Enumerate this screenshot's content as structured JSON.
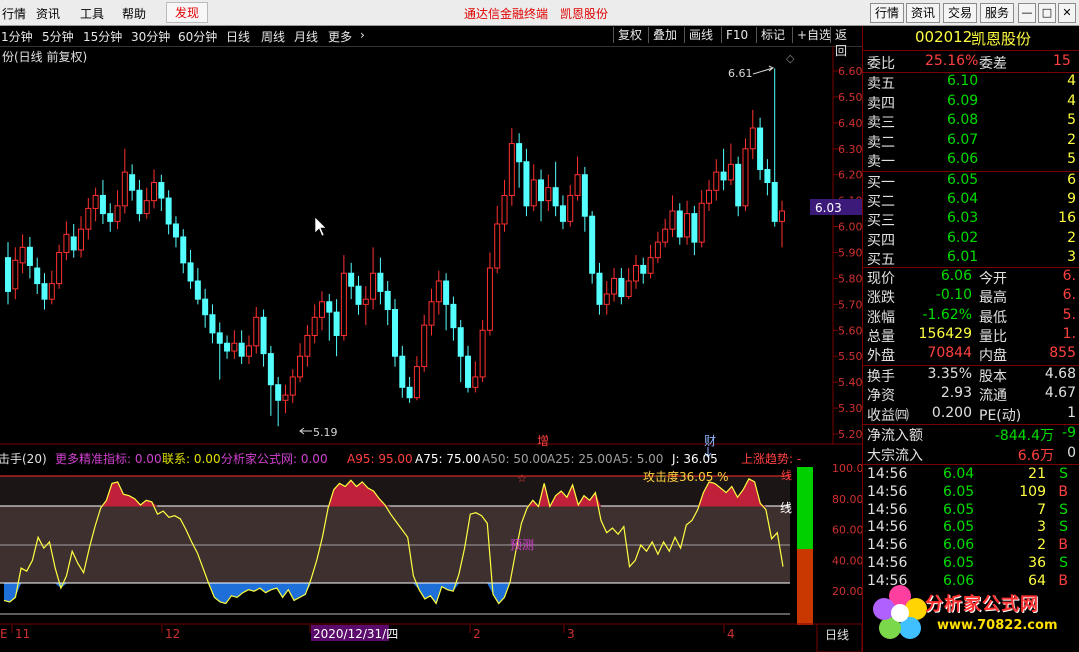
{
  "menu": {
    "items": [
      "行情",
      "资讯",
      "工具",
      "帮助"
    ],
    "discover": "发现",
    "title": "通达信金融终端　凯恩股份",
    "right_buttons": [
      "行情",
      "资讯",
      "交易",
      "服务"
    ]
  },
  "period_bar": {
    "periods": [
      "1分钟",
      "5分钟",
      "15分钟",
      "30分钟",
      "60分钟",
      "日线",
      "周线",
      "月线",
      "更多",
      "›"
    ],
    "tools": [
      "复权",
      "叠加",
      "画线",
      "F10",
      "标记",
      "+自选",
      "返回"
    ]
  },
  "chart": {
    "header": "份(日线 前复权)",
    "price_axis": [
      "6.60",
      "6.50",
      "6.40",
      "6.30",
      "6.20",
      "6.10",
      "6.00",
      "5.90",
      "5.80",
      "5.70",
      "5.60",
      "5.50",
      "5.40",
      "5.30",
      "5.20"
    ],
    "current_price_tag": "6.03",
    "high_annotation": "6.61",
    "low_annotation": "5.19",
    "marker_zeng": "增",
    "marker_cai": "财"
  },
  "indicator": {
    "name": "击手(20)",
    "legend": [
      {
        "text": "更多精准指标: 0.00",
        "color": "#d040d0"
      },
      {
        "text": "联系: 0.00",
        "color": "#e0e000"
      },
      {
        "text": "分析家公式网: 0.00",
        "color": "#d040d0"
      },
      {
        "text": "A95: 95.00",
        "color": "#ff4040"
      },
      {
        "text": "A75: 75.00",
        "color": "#ffffff"
      },
      {
        "text": "A50: 50.00",
        "color": "#a0a0a0"
      },
      {
        "text": "A25: 25.00",
        "color": "#a0a0a0"
      },
      {
        "text": "A5: 5.00",
        "color": "#a0a0a0"
      },
      {
        "text": "J: 36.05",
        "color": "#ffffff"
      },
      {
        "text": "上涨趋势: -",
        "color": "#ff4040"
      }
    ],
    "axis": [
      "100.00",
      "80.00",
      "60.00",
      "40.00",
      "20.00"
    ],
    "attack_label": "攻击度36.05 %",
    "predict_label": "预测",
    "line_label": "线",
    "line_label2": "线"
  },
  "date_axis": {
    "labels": [
      "11",
      "12",
      "2020/12/31/四",
      "2",
      "3",
      "4"
    ],
    "mode": "日线"
  },
  "quote": {
    "code": "002012",
    "name": "凯恩股份",
    "weibi_label": "委比",
    "weibi_value": "25.16%",
    "weicha_label": "委差",
    "weicha_value": "15",
    "sells": [
      {
        "label": "卖五",
        "price": "6.10",
        "vol": "4"
      },
      {
        "label": "卖四",
        "price": "6.09",
        "vol": "4"
      },
      {
        "label": "卖三",
        "price": "6.08",
        "vol": "5"
      },
      {
        "label": "卖二",
        "price": "6.07",
        "vol": "2"
      },
      {
        "label": "卖一",
        "price": "6.06",
        "vol": "5"
      }
    ],
    "buys": [
      {
        "label": "买一",
        "price": "6.05",
        "vol": "6"
      },
      {
        "label": "买二",
        "price": "6.04",
        "vol": "9"
      },
      {
        "label": "买三",
        "price": "6.03",
        "vol": "16"
      },
      {
        "label": "买四",
        "price": "6.02",
        "vol": "2"
      },
      {
        "label": "买五",
        "price": "6.01",
        "vol": "3"
      }
    ],
    "stats": [
      {
        "l1": "现价",
        "v1": "6.06",
        "c1": "#00dd00",
        "l2": "今开",
        "v2": "6."
      },
      {
        "l1": "涨跌",
        "v1": "-0.10",
        "c1": "#00dd00",
        "l2": "最高",
        "v2": "6."
      },
      {
        "l1": "涨幅",
        "v1": "-1.62%",
        "c1": "#00dd00",
        "l2": "最低",
        "v2": "5."
      },
      {
        "l1": "总量",
        "v1": "156429",
        "c1": "#ffff40",
        "l2": "量比",
        "v2": "1."
      },
      {
        "l1": "外盘",
        "v1": "70844",
        "c1": "#ff4040",
        "l2": "内盘",
        "v2": "855"
      }
    ],
    "stats2": [
      {
        "l1": "换手",
        "v1": "3.35%",
        "l2": "股本",
        "v2": "4.68"
      },
      {
        "l1": "净资",
        "v1": "2.93",
        "l2": "流通",
        "v2": "4.67"
      },
      {
        "l1": "收益㈣",
        "v1": "0.200",
        "l2": "PE(动)",
        "v2": "1"
      }
    ],
    "flows": [
      {
        "label": "净流入额",
        "value": "-844.4万",
        "extra": "-9"
      },
      {
        "label": "大宗流入",
        "value": "6.6万",
        "extra": "0"
      }
    ],
    "ticks": [
      {
        "time": "14:56",
        "price": "6.04",
        "vol": "21",
        "side": "S"
      },
      {
        "time": "14:56",
        "price": "6.05",
        "vol": "109",
        "side": "B"
      },
      {
        "time": "14:56",
        "price": "6.05",
        "vol": "7",
        "side": "S"
      },
      {
        "time": "14:56",
        "price": "6.05",
        "vol": "3",
        "side": "S"
      },
      {
        "time": "14:56",
        "price": "6.06",
        "vol": "2",
        "side": "B"
      },
      {
        "time": "14:56",
        "price": "6.05",
        "vol": "36",
        "side": "S"
      },
      {
        "time": "14:56",
        "price": "6.06",
        "vol": "64",
        "side": "B"
      }
    ]
  },
  "watermark": {
    "text": "分析家公式网",
    "url": "www.70822.com"
  },
  "chart_data": {
    "type": "candlestick",
    "price_range": [
      5.15,
      6.65
    ],
    "candles": [
      [
        5.88,
        5.75,
        5.94,
        5.7
      ],
      [
        5.76,
        5.87,
        5.92,
        5.72
      ],
      [
        5.86,
        5.92,
        5.97,
        5.82
      ],
      [
        5.92,
        5.85,
        5.96,
        5.8
      ],
      [
        5.84,
        5.78,
        5.88,
        5.74
      ],
      [
        5.78,
        5.72,
        5.82,
        5.68
      ],
      [
        5.72,
        5.78,
        5.83,
        5.7
      ],
      [
        5.78,
        5.9,
        5.93,
        5.76
      ],
      [
        5.9,
        5.97,
        6.02,
        5.87
      ],
      [
        5.96,
        5.91,
        6.01,
        5.88
      ],
      [
        5.91,
        5.99,
        6.04,
        5.88
      ],
      [
        5.99,
        6.07,
        6.11,
        5.95
      ],
      [
        6.07,
        6.12,
        6.15,
        6.02
      ],
      [
        6.12,
        6.05,
        6.18,
        6.01
      ],
      [
        6.05,
        6.02,
        6.09,
        5.98
      ],
      [
        6.02,
        6.08,
        6.14,
        5.99
      ],
      [
        6.08,
        6.21,
        6.3,
        6.05
      ],
      [
        6.2,
        6.14,
        6.24,
        6.1
      ],
      [
        6.14,
        6.05,
        6.18,
        6.02
      ],
      [
        6.05,
        6.1,
        6.15,
        6.03
      ],
      [
        6.1,
        6.17,
        6.22,
        6.07
      ],
      [
        6.17,
        6.11,
        6.2,
        6.06
      ],
      [
        6.11,
        6.01,
        6.14,
        5.97
      ],
      [
        6.01,
        5.96,
        6.04,
        5.92
      ],
      [
        5.96,
        5.86,
        5.99,
        5.82
      ],
      [
        5.86,
        5.79,
        5.91,
        5.76
      ],
      [
        5.79,
        5.72,
        5.84,
        5.7
      ],
      [
        5.72,
        5.66,
        5.76,
        5.61
      ],
      [
        5.66,
        5.59,
        5.7,
        5.55
      ],
      [
        5.59,
        5.55,
        5.63,
        5.41
      ],
      [
        5.55,
        5.52,
        5.58,
        5.49
      ],
      [
        5.52,
        5.55,
        5.6,
        5.49
      ],
      [
        5.55,
        5.5,
        5.6,
        5.47
      ],
      [
        5.5,
        5.54,
        5.58,
        5.47
      ],
      [
        5.54,
        5.65,
        5.69,
        5.51
      ],
      [
        5.65,
        5.51,
        5.68,
        5.46
      ],
      [
        5.51,
        5.39,
        5.54,
        5.27
      ],
      [
        5.39,
        5.33,
        5.42,
        5.23
      ],
      [
        5.33,
        5.35,
        5.39,
        5.28
      ],
      [
        5.35,
        5.42,
        5.45,
        5.32
      ],
      [
        5.42,
        5.5,
        5.55,
        5.4
      ],
      [
        5.5,
        5.58,
        5.62,
        5.46
      ],
      [
        5.58,
        5.65,
        5.7,
        5.55
      ],
      [
        5.65,
        5.71,
        5.75,
        5.6
      ],
      [
        5.71,
        5.67,
        5.74,
        5.56
      ],
      [
        5.67,
        5.58,
        5.72,
        5.5
      ],
      [
        5.58,
        5.82,
        5.89,
        5.56
      ],
      [
        5.82,
        5.77,
        5.86,
        5.72
      ],
      [
        5.77,
        5.7,
        5.81,
        5.66
      ],
      [
        5.7,
        5.72,
        5.77,
        5.62
      ],
      [
        5.72,
        5.82,
        5.92,
        5.68
      ],
      [
        5.82,
        5.75,
        5.88,
        5.7
      ],
      [
        5.75,
        5.68,
        5.79,
        5.62
      ],
      [
        5.68,
        5.5,
        5.72,
        5.46
      ],
      [
        5.5,
        5.38,
        5.54,
        5.34
      ],
      [
        5.38,
        5.34,
        5.42,
        5.32
      ],
      [
        5.34,
        5.46,
        5.5,
        5.33
      ],
      [
        5.46,
        5.62,
        5.66,
        5.44
      ],
      [
        5.62,
        5.71,
        5.76,
        5.58
      ],
      [
        5.71,
        5.79,
        5.83,
        5.66
      ],
      [
        5.79,
        5.7,
        5.82,
        5.6
      ],
      [
        5.7,
        5.61,
        5.73,
        5.56
      ],
      [
        5.61,
        5.5,
        5.64,
        5.4
      ],
      [
        5.5,
        5.38,
        5.54,
        5.36
      ],
      [
        5.38,
        5.42,
        5.48,
        5.36
      ],
      [
        5.42,
        5.6,
        5.64,
        5.4
      ],
      [
        5.6,
        5.84,
        5.9,
        5.58
      ],
      [
        5.84,
        6.01,
        6.08,
        5.82
      ],
      [
        6.01,
        6.12,
        6.18,
        5.98
      ],
      [
        6.12,
        6.32,
        6.38,
        6.08
      ],
      [
        6.32,
        6.25,
        6.36,
        6.15
      ],
      [
        6.25,
        6.08,
        6.3,
        6.04
      ],
      [
        6.08,
        6.18,
        6.24,
        6.06
      ],
      [
        6.18,
        6.1,
        6.22,
        6.02
      ],
      [
        6.1,
        6.15,
        6.2,
        6.06
      ],
      [
        6.15,
        6.08,
        6.25,
        6.04
      ],
      [
        6.08,
        6.02,
        6.12,
        5.99
      ],
      [
        6.02,
        6.12,
        6.16,
        6.0
      ],
      [
        6.12,
        6.2,
        6.27,
        6.1
      ],
      [
        6.2,
        6.04,
        6.23,
        5.98
      ],
      [
        6.04,
        5.82,
        6.06,
        5.78
      ],
      [
        5.82,
        5.7,
        5.86,
        5.66
      ],
      [
        5.7,
        5.74,
        5.79,
        5.66
      ],
      [
        5.74,
        5.8,
        5.84,
        5.71
      ],
      [
        5.8,
        5.73,
        5.84,
        5.7
      ],
      [
        5.73,
        5.79,
        5.84,
        5.72
      ],
      [
        5.79,
        5.85,
        5.89,
        5.76
      ],
      [
        5.85,
        5.82,
        5.88,
        5.78
      ],
      [
        5.82,
        5.88,
        5.93,
        5.8
      ],
      [
        5.88,
        5.94,
        5.98,
        5.86
      ],
      [
        5.94,
        5.99,
        6.03,
        5.92
      ],
      [
        5.99,
        6.06,
        6.12,
        5.96
      ],
      [
        6.06,
        5.96,
        6.09,
        5.93
      ],
      [
        5.96,
        6.05,
        6.1,
        5.93
      ],
      [
        6.05,
        5.94,
        6.08,
        5.89
      ],
      [
        5.94,
        6.09,
        6.14,
        5.92
      ],
      [
        6.09,
        6.14,
        6.18,
        6.06
      ],
      [
        6.14,
        6.21,
        6.26,
        6.1
      ],
      [
        6.21,
        6.18,
        6.3,
        6.14
      ],
      [
        6.18,
        6.24,
        6.32,
        6.16
      ],
      [
        6.24,
        6.08,
        6.27,
        6.04
      ],
      [
        6.08,
        6.3,
        6.34,
        6.06
      ],
      [
        6.3,
        6.38,
        6.45,
        6.26
      ],
      [
        6.38,
        6.22,
        6.42,
        6.18
      ],
      [
        6.22,
        6.17,
        6.26,
        6.12
      ],
      [
        6.17,
        6.02,
        6.61,
        6.0
      ],
      [
        6.02,
        6.06,
        6.1,
        5.92
      ]
    ],
    "oscillator": [
      14,
      13,
      16,
      35,
      33,
      40,
      55,
      48,
      52,
      35,
      22,
      30,
      46,
      38,
      32,
      48,
      62,
      74,
      79,
      90,
      91,
      83,
      82,
      80,
      76,
      79,
      78,
      70,
      72,
      68,
      69,
      67,
      60,
      52,
      45,
      35,
      25,
      16,
      13,
      12,
      17,
      16,
      19,
      21,
      20,
      22,
      19,
      21,
      22,
      16,
      21,
      14,
      16,
      18,
      28,
      40,
      55,
      74,
      86,
      90,
      88,
      92,
      88,
      91,
      87,
      85,
      80,
      76,
      70,
      65,
      60,
      55,
      30,
      21,
      15,
      17,
      12,
      23,
      21,
      20,
      31,
      48,
      70,
      71,
      69,
      64,
      18,
      12,
      16,
      26,
      46,
      64,
      74,
      79,
      75,
      90,
      75,
      82,
      85,
      81,
      89,
      76,
      82,
      79,
      84,
      66,
      58,
      61,
      57,
      62,
      36,
      40,
      50,
      46,
      52,
      44,
      52,
      46,
      55,
      48,
      63,
      66,
      73,
      84,
      91,
      90,
      87,
      84,
      88,
      81,
      86,
      93,
      91,
      77,
      73,
      54,
      58,
      36
    ]
  }
}
